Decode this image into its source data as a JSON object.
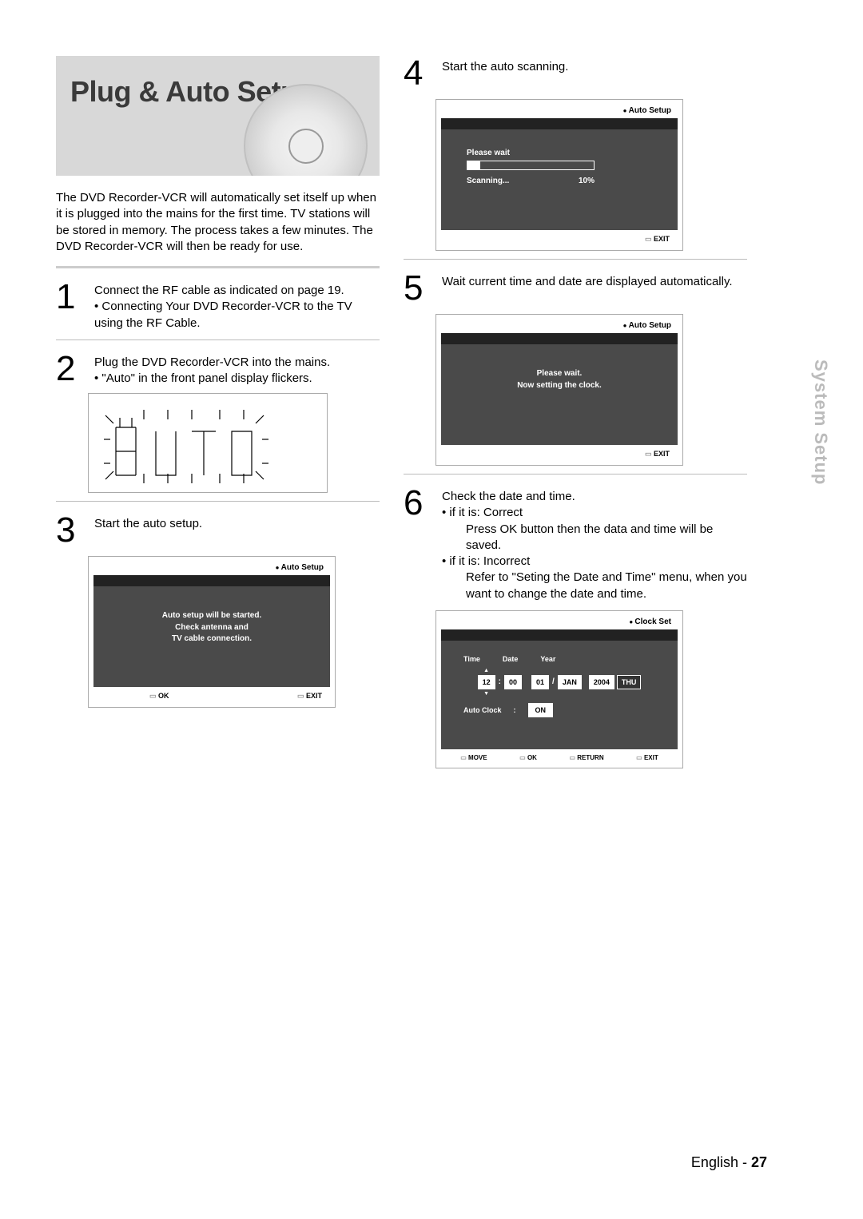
{
  "hero": {
    "title": "Plug & Auto Setup"
  },
  "intro": "The DVD Recorder-VCR will automatically set itself up when it is plugged into the mains for the first time. TV stations will be stored in memory. The process takes a few minutes. The DVD Recorder-VCR will then be ready for use.",
  "steps": {
    "1": {
      "line1": "Connect the RF cable as indicated on page 19.",
      "bullet1": "• Connecting Your DVD Recorder-VCR to the TV using the RF Cable."
    },
    "2": {
      "line1": "Plug the DVD Recorder-VCR into the mains.",
      "bullet1": "• \"Auto\" in the front panel display flickers."
    },
    "3": {
      "line1": "Start the auto setup."
    },
    "4": {
      "line1": "Start the auto scanning."
    },
    "5": {
      "line1": "Wait current time and date are displayed automatically."
    },
    "6": {
      "line1": "Check the date and time.",
      "bullet1": "• if it is: Correct",
      "sub1": "Press OK button then the data and time will be saved.",
      "bullet2": "• if it is: Incorrect",
      "sub2": "Refer to \"Seting the Date and Time\" menu, when you want to change the date and time."
    }
  },
  "screens": {
    "autosetup": {
      "title": "Auto Setup",
      "lines": [
        "Auto setup will be started.",
        "Check antenna and",
        "TV cable connection."
      ],
      "ok": "OK",
      "exit": "EXIT"
    },
    "scanning": {
      "title": "Auto Setup",
      "please_wait": "Please wait",
      "scanning": "Scanning...",
      "percent": "10%",
      "exit": "EXIT"
    },
    "clockwait": {
      "title": "Auto Setup",
      "lines": [
        "Please wait.",
        "Now setting the clock."
      ],
      "exit": "EXIT"
    },
    "clockset": {
      "title": "Clock Set",
      "labels": {
        "time": "Time",
        "date": "Date",
        "year": "Year"
      },
      "values": {
        "hh": "12",
        "mm": "00",
        "dd": "01",
        "mon": "JAN",
        "yyyy": "2004",
        "dow": "THU"
      },
      "auto_clock_label": "Auto Clock",
      "auto_clock_value": "ON",
      "move": "MOVE",
      "ok": "OK",
      "ret": "RETURN",
      "exit": "EXIT"
    }
  },
  "sidetab": "System Setup",
  "footer": {
    "lang": "English",
    "sep": " - ",
    "page": "27"
  }
}
